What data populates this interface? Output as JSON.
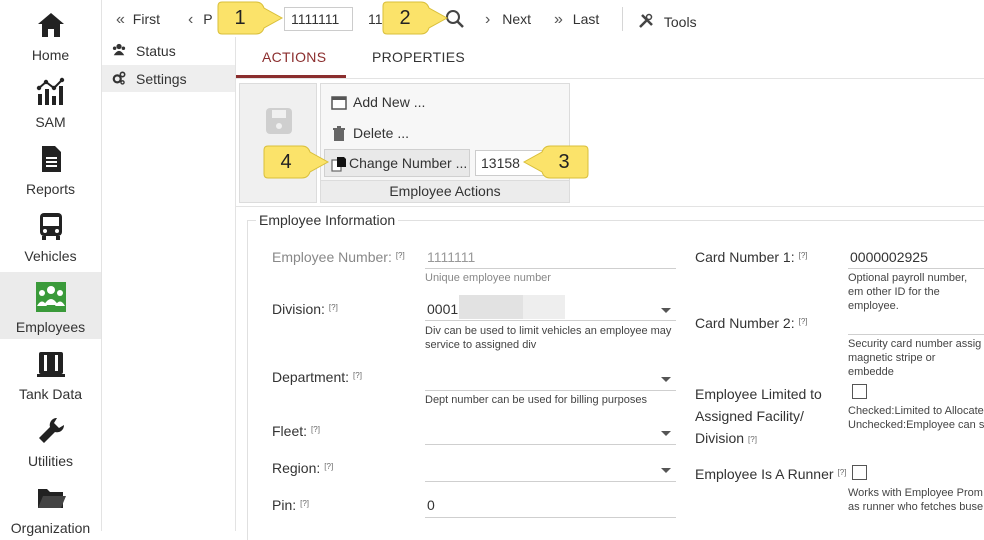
{
  "rail": {
    "items": [
      {
        "label": "Home",
        "icon": "home-icon"
      },
      {
        "label": "SAM",
        "icon": "analytics-icon"
      },
      {
        "label": "Reports",
        "icon": "document-icon"
      },
      {
        "label": "Vehicles",
        "icon": "bus-icon"
      },
      {
        "label": "Employees",
        "icon": "employees-icon"
      },
      {
        "label": "Tank Data",
        "icon": "tank-icon"
      },
      {
        "label": "Utilities",
        "icon": "wrench-icon"
      },
      {
        "label": "Organization",
        "icon": "folder-icon"
      }
    ],
    "active": "Employees",
    "accent": "#3a9a3a"
  },
  "subnav": {
    "items": [
      {
        "label": "Status",
        "icon": "users-icon"
      },
      {
        "label": "Settings",
        "icon": "cogs-icon"
      }
    ]
  },
  "toolbar": {
    "first": "First",
    "prev": "P",
    "record_value": "1111111",
    "count_text": "118",
    "next": "Next",
    "last": "Last",
    "tools": "Tools"
  },
  "tabs": {
    "actions": "ACTIONS",
    "properties": "PROPERTIES",
    "accent": "#8b2e2e"
  },
  "ribbon": {
    "save_label": "S",
    "add_new": "Add New ...",
    "delete": "Delete ...",
    "change_number": "Change Number ...",
    "change_number_value": "13158",
    "group_title": "Employee Actions"
  },
  "form": {
    "legend": "Employee Information",
    "employee_number": {
      "label": "Employee Number:",
      "help": "[?]",
      "value": "1111111",
      "hint": "Unique employee number"
    },
    "division": {
      "label": "Division:",
      "help": "[?]",
      "value": "0001",
      "hint": "Div can be used to limit vehicles an employee may service to assigned div"
    },
    "department": {
      "label": "Department:",
      "help": "[?]",
      "value": "",
      "hint": "Dept number can be used for billing purposes"
    },
    "fleet": {
      "label": "Fleet:",
      "help": "[?]",
      "value": ""
    },
    "region": {
      "label": "Region:",
      "help": "[?]",
      "value": ""
    },
    "pin": {
      "label": "Pin:",
      "help": "[?]",
      "value": "0"
    },
    "card1": {
      "label": "Card Number 1:",
      "help": "[?]",
      "value": "0000002925",
      "hint": "Optional payroll number, em other ID for the employee."
    },
    "card2": {
      "label": "Card Number 2:",
      "help": "[?]",
      "value": "",
      "hint": "Security card number assig magnetic stripe or embedde"
    },
    "limited": {
      "label_line1": "Employee Limited to",
      "label_line2": "Assigned Facility/",
      "label_line3": "Division",
      "help": "[?]",
      "hint_line1": "Checked:Limited to Allocate",
      "hint_line2": "Unchecked:Employee can s"
    },
    "runner": {
      "label": "Employee Is A Runner",
      "help": "[?]",
      "hint_line1": "Works with Employee Prom",
      "hint_line2": "as runner who fetches buse"
    }
  },
  "callouts": {
    "c1": "1",
    "c2": "2",
    "c3": "3",
    "c4": "4",
    "color": "#fbe36a"
  }
}
